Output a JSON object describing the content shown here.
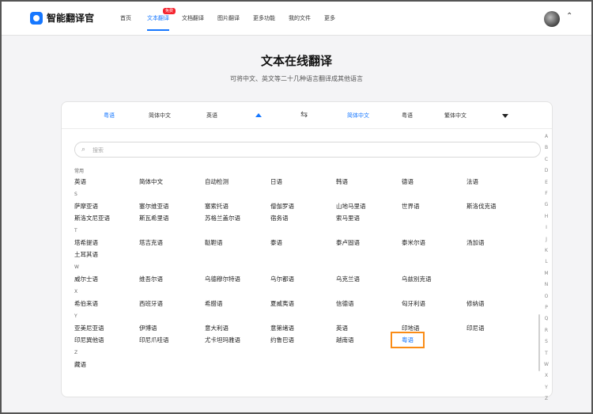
{
  "app": {
    "name": "智能翻译官"
  },
  "nav": [
    {
      "label": "首页",
      "active": false
    },
    {
      "label": "文本翻译",
      "active": true,
      "badge": "免费"
    },
    {
      "label": "文档翻译",
      "active": false
    },
    {
      "label": "图片翻译",
      "active": false
    },
    {
      "label": "更多功能",
      "active": false
    },
    {
      "label": "我的文件",
      "active": false
    },
    {
      "label": "更多",
      "active": false
    }
  ],
  "hero": {
    "title": "文本在线翻译",
    "subtitle": "可将中文、英文等二十几种语言翻译成其他语言"
  },
  "lang_bar": {
    "source": [
      "粤语",
      "简体中文",
      "英语"
    ],
    "target": [
      "简体中文",
      "粤语",
      "繁体中文"
    ]
  },
  "search": {
    "placeholder": "搜索"
  },
  "sections": [
    {
      "letter": "常用",
      "items": [
        "英语",
        "简体中文",
        "自动检测",
        "日语",
        "韩语",
        "德语",
        "法语"
      ]
    },
    {
      "letter": "S",
      "items": [
        "萨摩亚语",
        "塞尔维亚语",
        "塞索托语",
        "僧伽罗语",
        "山地马里语",
        "世界语",
        "斯洛伐克语",
        "斯洛文尼亚语",
        "斯瓦希里语",
        "苏格兰盖尔语",
        "宿务语",
        "索马里语"
      ]
    },
    {
      "letter": "T",
      "items": [
        "塔希提语",
        "塔吉克语",
        "鞑靼语",
        "泰语",
        "泰卢固语",
        "泰米尔语",
        "汤加语",
        "土耳其语"
      ]
    },
    {
      "letter": "W",
      "items": [
        "威尔士语",
        "维吾尔语",
        "乌德穆尔特语",
        "乌尔都语",
        "乌克兰语",
        "乌兹别克语"
      ]
    },
    {
      "letter": "X",
      "items": [
        "希伯来语",
        "西班牙语",
        "希腊语",
        "夏威夷语",
        "信德语",
        "匈牙利语",
        "修纳语"
      ]
    },
    {
      "letter": "Y",
      "items": [
        "亚美尼亚语",
        "伊博语",
        "意大利语",
        "意第绪语",
        "英语",
        "印地语",
        "印尼语",
        "印尼巽他语",
        "印尼爪哇语",
        "尤卡坦玛雅语",
        "约鲁巴语",
        "越南语",
        "粤语"
      ]
    },
    {
      "letter": "Z",
      "items": [
        "藏语"
      ]
    }
  ],
  "selected_language": "粤语",
  "az_index": [
    "A",
    "B",
    "C",
    "D",
    "E",
    "F",
    "G",
    "H",
    "I",
    "J",
    "K",
    "L",
    "M",
    "N",
    "O",
    "P",
    "Q",
    "R",
    "S",
    "T",
    "W",
    "X",
    "Y",
    "Z"
  ],
  "colors": {
    "accent": "#1677ff",
    "selected_border": "#fa8c16",
    "badge": "#f5222d"
  }
}
